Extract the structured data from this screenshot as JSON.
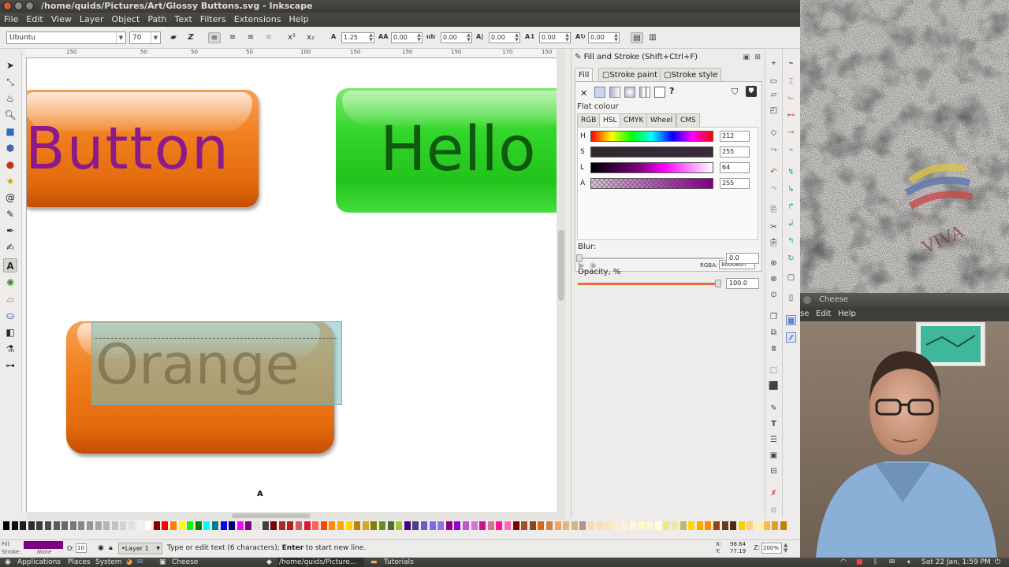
{
  "window": {
    "title": "/home/quids/Pictures/Art/Glossy Buttons.svg - Inkscape"
  },
  "menu": [
    "File",
    "Edit",
    "View",
    "Layer",
    "Object",
    "Path",
    "Text",
    "Filters",
    "Extensions",
    "Help"
  ],
  "text_toolbar": {
    "font_family": "Ubuntu",
    "font_size": "70",
    "line_spacing": "1.25",
    "letter_spacing": "0.00",
    "word_spacing": "0.00",
    "kern_h": "0.00",
    "kern_v": "0.00",
    "rotation": "0.00",
    "superscript": "x²",
    "subscript": "x₂"
  },
  "ruler": {
    "ticks": [
      "150",
      "50",
      "50",
      "50",
      "100",
      "150",
      "150",
      "150",
      "170",
      "150"
    ]
  },
  "canvas": {
    "button1_text": "Button",
    "button2_text": "Hello",
    "button3_text": "Orange",
    "cursor": "A"
  },
  "fill_stroke": {
    "title": "Fill and Stroke (Shift+Ctrl+F)",
    "tabs": [
      "Fill",
      "Stroke paint",
      "Stroke style"
    ],
    "paint_type": "Flat colour",
    "model_tabs": [
      "RGB",
      "HSL",
      "CMYK",
      "Wheel",
      "CMS"
    ],
    "sliders": [
      {
        "label": "H",
        "value": "212"
      },
      {
        "label": "S",
        "value": "255"
      },
      {
        "label": "L",
        "value": "64"
      },
      {
        "label": "A",
        "value": "255"
      }
    ],
    "rgba_label": "RGBA:",
    "rgba_value": "800080ff",
    "blur_label": "Blur:",
    "blur_value": "0.0",
    "opacity_label": "Opacity, %",
    "opacity_value": "100.0",
    "opacity_fraction": 1.0,
    "help_icon": "?"
  },
  "status": {
    "fill_label": "Fill:",
    "stroke_label": "Stroke:",
    "stroke_value": "None",
    "fill_color": "#800080",
    "opacity_label": "O:",
    "opacity_value": "10",
    "layer": "•Layer 1",
    "message_pre": "Type or edit text (6 characters); ",
    "message_bold": "Enter",
    "message_post": " to start new line.",
    "x_label": "X:",
    "x_value": "98.64",
    "y_label": "Y:",
    "y_value": "77.19",
    "zoom_label": "Z:",
    "zoom_value": "200%"
  },
  "cheese": {
    "title": "Cheese",
    "menu": [
      "se",
      "Edit",
      "Help"
    ]
  },
  "taskbar": {
    "applications": "Applications",
    "places": "Places",
    "system": "System",
    "cheese": "Cheese",
    "inkscape": "/home/quids/Picture...",
    "tutorials": "Tutorials",
    "clock": "Sat 22 Jan,  1:59 PM"
  },
  "colors": {
    "accent_purple": "#800080",
    "orange": "#f07f1d",
    "green": "#33d62a"
  }
}
